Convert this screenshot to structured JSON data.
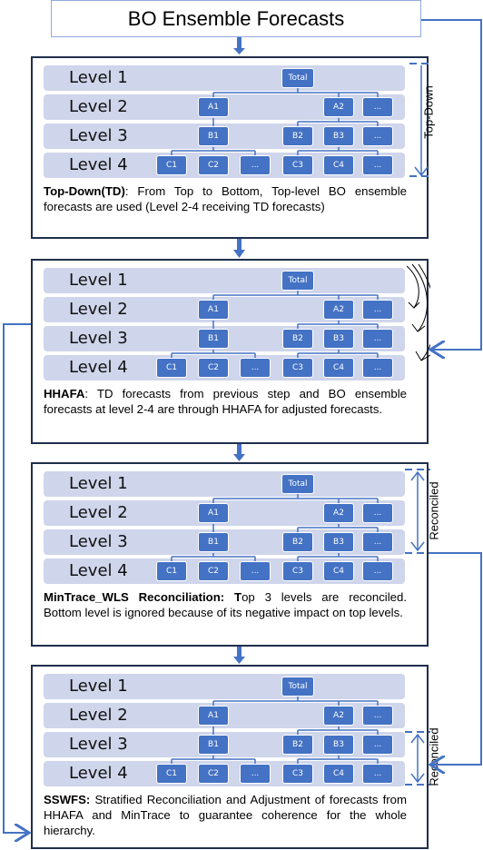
{
  "header": {
    "title": "BO Ensemble Forecasts"
  },
  "levels": [
    "Level 1",
    "Level 2",
    "Level 3",
    "Level 4"
  ],
  "nodes": {
    "level1": [
      "Total"
    ],
    "level2": [
      "A1",
      "A2",
      "..."
    ],
    "level3": [
      "B1",
      "B2",
      "B3",
      "..."
    ],
    "level4": [
      "C1",
      "C2",
      "...",
      "C3",
      "C4",
      "..."
    ]
  },
  "panels": [
    {
      "id": "top-down",
      "desc_bold": "Top-Down(TD)",
      "desc_text": ": From Top to Bottom, Top-level BO ensemble forecasts are used (Level 2-4 receiving TD forecasts)",
      "side_label": "Top-Down"
    },
    {
      "id": "hhafa",
      "desc_bold": "HHAFA",
      "desc_text": ": TD forecasts from previous step and BO ensemble forecasts at level 2-4 are through HHAFA for adjusted forecasts.",
      "side_label": ""
    },
    {
      "id": "mintrace",
      "desc_bold": "MinTrace_WLS Reconciliation: T",
      "desc_text": "op 3 levels are reconciled. Bottom level is ignored because of its negative impact on top levels.",
      "side_label": "Reconciled"
    },
    {
      "id": "sswfs",
      "desc_bold": "SSWFS:",
      "desc_text": " Stratified Reconciliation and Adjustment of forecasts from HHAFA and MinTrace to guarantee coherence for the whole hierarchy.",
      "side_label": "Reconciled"
    }
  ],
  "colors": {
    "node": "#4472c4",
    "band": "#cfd5ea",
    "connector": "#4472c4",
    "panel_border": "#1f2f4c"
  }
}
